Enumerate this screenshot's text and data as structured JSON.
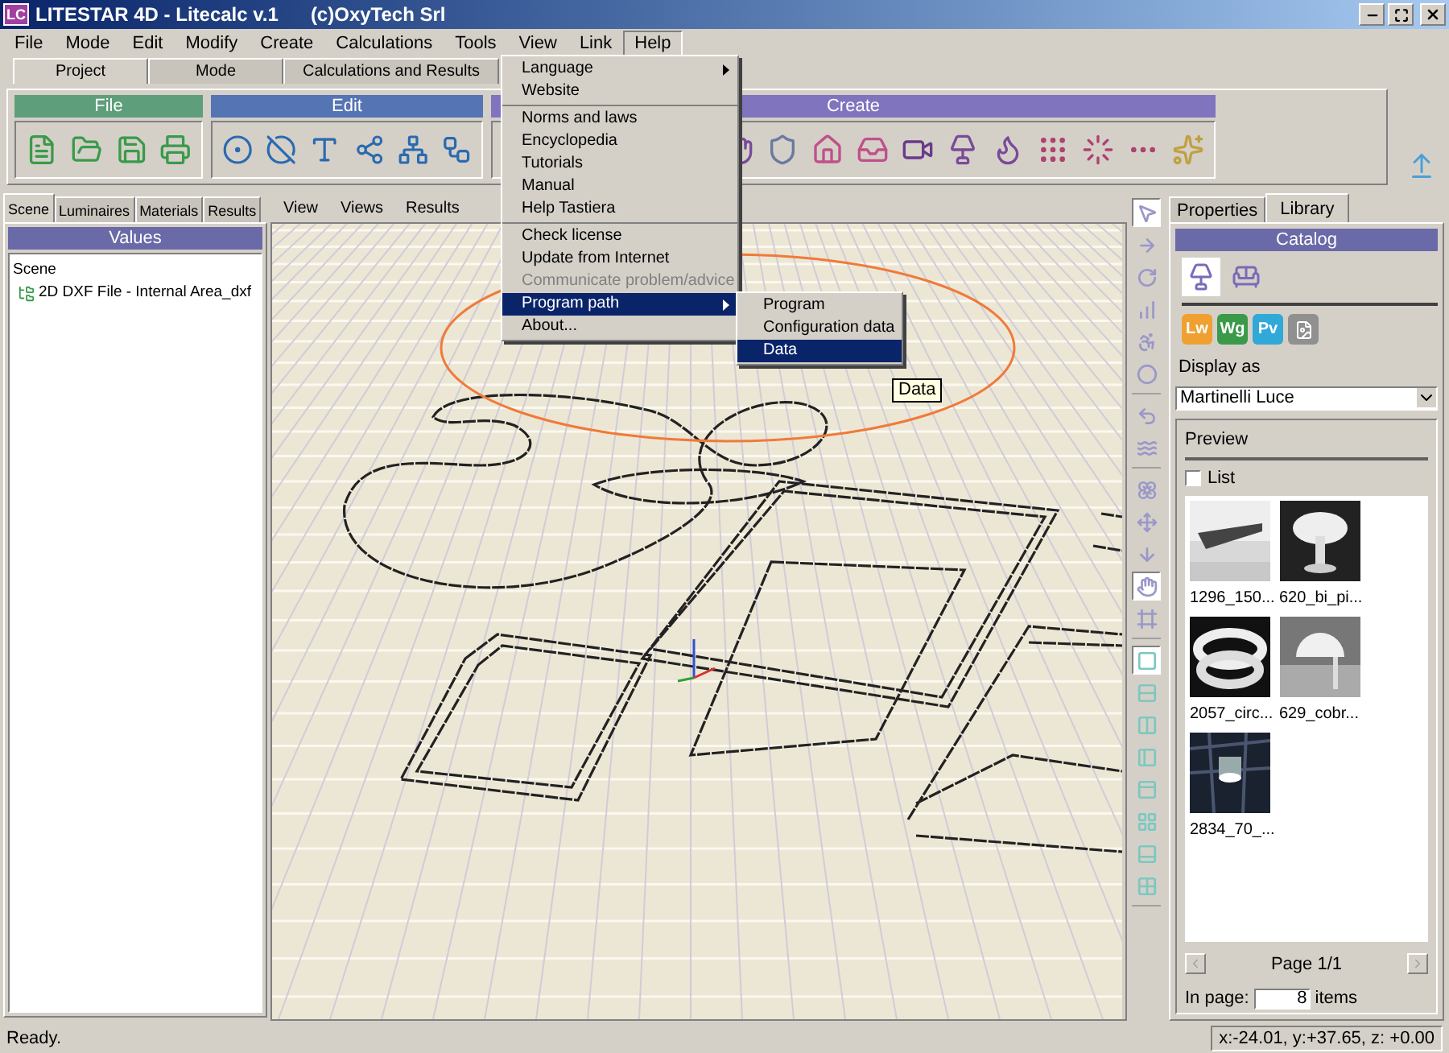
{
  "window": {
    "title": "LITESTAR 4D - Litecalc v.1",
    "company": "(c)OxyTech Srl",
    "app_icon": "LC"
  },
  "menu_bar": [
    {
      "label": "File",
      "selected": false
    },
    {
      "label": "Mode",
      "selected": false
    },
    {
      "label": "Edit",
      "selected": false
    },
    {
      "label": "Modify",
      "selected": false
    },
    {
      "label": "Create",
      "selected": false
    },
    {
      "label": "Calculations",
      "selected": false
    },
    {
      "label": "Tools",
      "selected": false
    },
    {
      "label": "View",
      "selected": false
    },
    {
      "label": "Link",
      "selected": false
    },
    {
      "label": "Help",
      "selected": true
    }
  ],
  "ribbon_tabs": [
    {
      "label": "Project",
      "selected": true
    },
    {
      "label": "Mode",
      "selected": false
    },
    {
      "label": "Calculations and Results",
      "selected": false
    }
  ],
  "ribbon_groups": [
    {
      "title": "File",
      "color": "#5f9e7a",
      "kind": "file"
    },
    {
      "title": "Edit",
      "color": "#5574b4",
      "kind": "edit"
    },
    {
      "title": "Create",
      "color": "#8074be",
      "kind": "create"
    }
  ],
  "help_menu": {
    "sections": [
      [
        {
          "label": "Language",
          "has_submenu": true,
          "disabled": false,
          "selected": false
        },
        {
          "label": "Website",
          "has_submenu": false,
          "disabled": false,
          "selected": false
        }
      ],
      [
        {
          "label": "Norms and laws",
          "has_submenu": false,
          "disabled": false,
          "selected": false
        },
        {
          "label": "Encyclopedia",
          "has_submenu": false,
          "disabled": false,
          "selected": false
        },
        {
          "label": "Tutorials",
          "has_submenu": false,
          "disabled": false,
          "selected": false
        },
        {
          "label": "Manual",
          "has_submenu": false,
          "disabled": false,
          "selected": false
        },
        {
          "label": "Help Tastiera",
          "has_submenu": false,
          "disabled": false,
          "selected": false
        }
      ],
      [
        {
          "label": "Check license",
          "has_submenu": false,
          "disabled": false,
          "selected": false
        },
        {
          "label": "Update from Internet",
          "has_submenu": false,
          "disabled": false,
          "selected": false
        },
        {
          "label": "Communicate problem/advice",
          "has_submenu": false,
          "disabled": true,
          "selected": false
        },
        {
          "label": "Program path",
          "has_submenu": true,
          "disabled": false,
          "selected": true
        },
        {
          "label": "About...",
          "has_submenu": false,
          "disabled": false,
          "selected": false
        }
      ]
    ]
  },
  "submenu": {
    "items": [
      {
        "label": "Program",
        "selected": false
      },
      {
        "label": "Configuration data",
        "selected": false
      },
      {
        "label": "Data",
        "selected": true
      }
    ]
  },
  "tooltip": "Data",
  "left_panel": {
    "tabs": [
      {
        "label": "Scene",
        "selected": true
      },
      {
        "label": "Luminaires",
        "selected": false
      },
      {
        "label": "Materials",
        "selected": false
      },
      {
        "label": "Results",
        "selected": false
      }
    ],
    "header": "Values",
    "tree": [
      {
        "label": "Scene",
        "children": [
          {
            "label": "2D DXF File - Internal Area_dxf"
          }
        ]
      }
    ]
  },
  "viewport": {
    "menu": [
      "View",
      "Views",
      "Results"
    ]
  },
  "vertical_toolbar": [
    [
      {
        "kind": "pointer",
        "selected": true
      },
      {
        "kind": "forward",
        "selected": false
      },
      {
        "kind": "rotate",
        "selected": false
      },
      {
        "kind": "steps",
        "selected": false
      },
      {
        "kind": "arm",
        "selected": false
      },
      {
        "kind": "oval",
        "selected": false
      }
    ],
    [
      {
        "kind": "undo",
        "selected": false
      },
      {
        "kind": "wave",
        "selected": false
      }
    ],
    [
      {
        "kind": "flower",
        "selected": false
      },
      {
        "kind": "move",
        "selected": false
      },
      {
        "kind": "down",
        "selected": false
      },
      {
        "kind": "hand",
        "selected": true
      },
      {
        "kind": "frame",
        "selected": false
      }
    ],
    [
      {
        "kind": "single",
        "selected": true
      },
      {
        "kind": "rows",
        "selected": false
      },
      {
        "kind": "columns",
        "selected": false
      },
      {
        "kind": "left",
        "selected": false
      },
      {
        "kind": "top",
        "selected": false
      },
      {
        "kind": "grid",
        "selected": false
      },
      {
        "kind": "bottom",
        "selected": false
      },
      {
        "kind": "quad",
        "selected": false
      }
    ]
  ],
  "right_panel": {
    "tabs": [
      {
        "label": "Properties",
        "selected": false
      },
      {
        "label": "Library",
        "selected": true
      }
    ],
    "header": "Catalog",
    "catalog_modes": [
      {
        "kind": "luminaire",
        "selected": true
      },
      {
        "kind": "furniture",
        "selected": false
      }
    ],
    "formats": [
      {
        "label": "Lw",
        "color": "#f0a030"
      },
      {
        "label": "Wg",
        "color": "#3a9a4a"
      },
      {
        "label": "Pv",
        "color": "#30a8d8"
      }
    ],
    "display_as_label": "Display as",
    "display_as_value": "Martinelli Luce",
    "preview": {
      "title": "Preview",
      "list_label": "List",
      "list_checked": false,
      "thumbnails": [
        {
          "label": "1296_150..."
        },
        {
          "label": "620_bi_pi..."
        },
        {
          "label": "2057_circ..."
        },
        {
          "label": "629_cobr..."
        },
        {
          "label": "2834_70_..."
        }
      ],
      "page": "Page 1/1",
      "in_page_label": "In page:",
      "in_page_value": "8",
      "items_label": "items"
    }
  },
  "status_bar": {
    "message": "Ready.",
    "coordinates": "x:-24.01, y:+37.65, z: +0.00"
  }
}
